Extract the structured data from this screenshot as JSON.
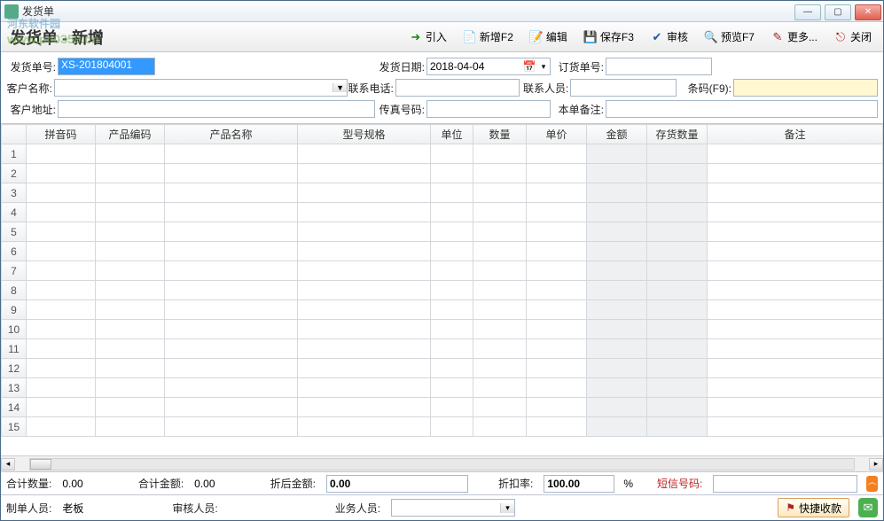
{
  "titlebar": {
    "title": "发货单"
  },
  "watermark": {
    "line1": "河东软件园",
    "line2": "www.pc0359.cn"
  },
  "page_title": "发货单 - 新增",
  "toolbar": {
    "import": "引入",
    "new": "新增F2",
    "edit": "编辑",
    "save": "保存F3",
    "audit": "审核",
    "preview": "预览F7",
    "more": "更多...",
    "close": "关闭"
  },
  "form": {
    "bill_no_label": "发货单号:",
    "bill_no_value": "XS-201804001",
    "ship_date_label": "发货日期:",
    "ship_date_value": "2018-04-04",
    "order_no_label": "订货单号:",
    "order_no_value": "",
    "cust_name_label": "客户名称:",
    "cust_name_value": "",
    "phone_label": "联系电话:",
    "phone_value": "",
    "contact_label": "联系人员:",
    "contact_value": "",
    "barcode_label": "条码(F9):",
    "barcode_value": "",
    "addr_label": "客户地址:",
    "addr_value": "",
    "fax_label": "传真号码:",
    "fax_value": "",
    "remark_label": "本单备注:",
    "remark_value": ""
  },
  "columns": [
    "拼音码",
    "产品编码",
    "产品名称",
    "型号规格",
    "单位",
    "数量",
    "单价",
    "金额",
    "存货数量",
    "备注"
  ],
  "row_count": 15,
  "footer1": {
    "qty_label": "合计数量:",
    "qty_value": "0.00",
    "amt_label": "合计金额:",
    "amt_value": "0.00",
    "disc_amt_label": "折后金额:",
    "disc_amt_value": "0.00",
    "disc_rate_label": "折扣率:",
    "disc_rate_value": "100.00",
    "disc_rate_suffix": "%",
    "sms_label": "短信号码:",
    "sms_value": ""
  },
  "footer2": {
    "maker_label": "制单人员:",
    "maker_value": "老板",
    "auditor_label": "审核人员:",
    "auditor_value": "",
    "clerk_label": "业务人员:",
    "clerk_value": "",
    "receipt_btn": "快捷收款"
  }
}
